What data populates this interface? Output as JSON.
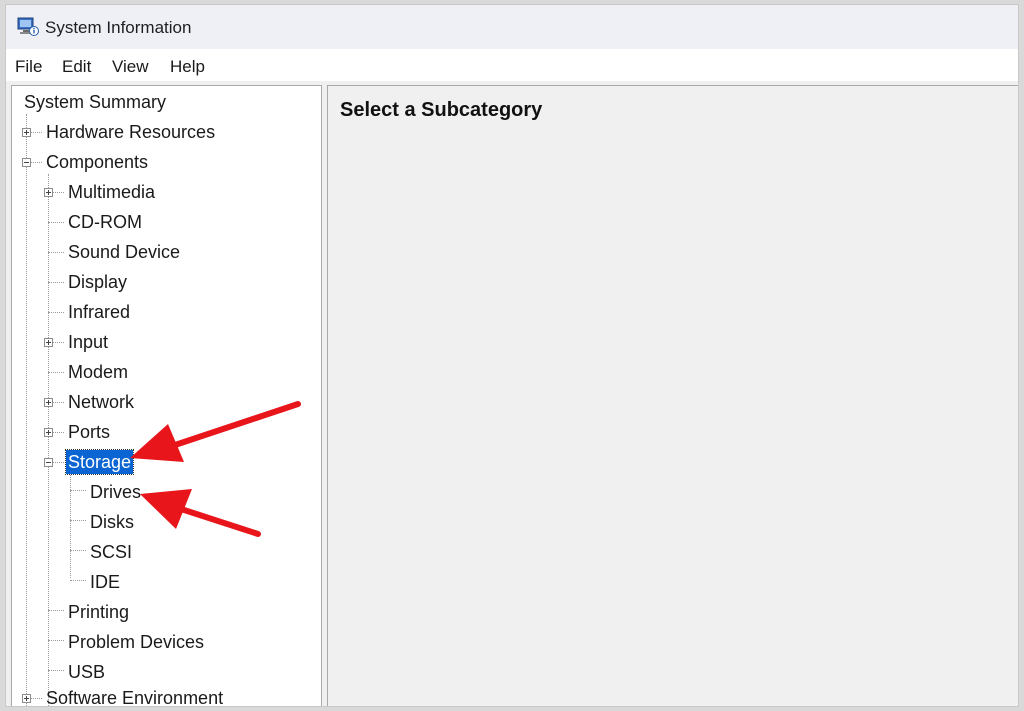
{
  "window": {
    "title": "System Information"
  },
  "menu": {
    "file": "File",
    "edit": "Edit",
    "view": "View",
    "help": "Help"
  },
  "tree": {
    "system_summary": "System Summary",
    "hardware_resources": "Hardware Resources",
    "components": "Components",
    "multimedia": "Multimedia",
    "cd_rom": "CD-ROM",
    "sound_device": "Sound Device",
    "display": "Display",
    "infrared": "Infrared",
    "input": "Input",
    "modem": "Modem",
    "network": "Network",
    "ports": "Ports",
    "storage": "Storage",
    "drives": "Drives",
    "disks": "Disks",
    "scsi": "SCSI",
    "ide": "IDE",
    "printing": "Printing",
    "problem_devices": "Problem Devices",
    "usb": "USB",
    "software_environment": "Software Environment"
  },
  "detail": {
    "heading": "Select a Subcategory"
  },
  "colors": {
    "selection": "#0a64d2",
    "annotation_arrow": "#e8151b"
  }
}
